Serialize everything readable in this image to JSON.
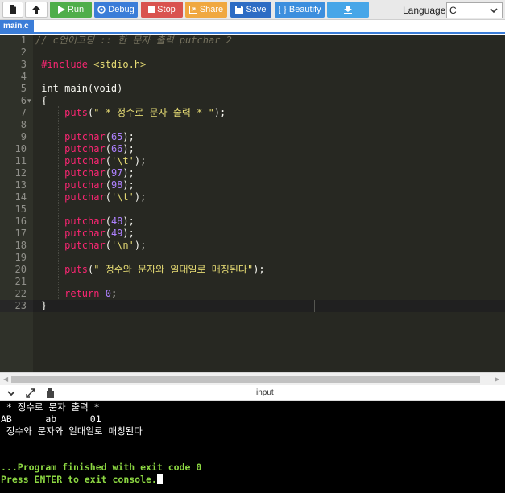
{
  "toolbar": {
    "run_label": "Run",
    "debug_label": "Debug",
    "stop_label": "Stop",
    "share_label": "Share",
    "save_label": "Save",
    "beautify_label": "{ } Beautify",
    "language_label": "Language",
    "language_value": "C"
  },
  "tab": {
    "name": "main.c"
  },
  "editor": {
    "line_numbers": [
      "1",
      "2",
      "3",
      "4",
      "5",
      "6",
      "7",
      "8",
      "9",
      "10",
      "11",
      "12",
      "13",
      "14",
      "15",
      "16",
      "17",
      "18",
      "19",
      "20",
      "21",
      "22",
      "23"
    ],
    "lines": [
      {
        "n": 1,
        "tokens": [
          [
            "c-comment",
            "// c언어코딩 :: 한 문자 출력 putchar 2"
          ]
        ]
      },
      {
        "n": 3,
        "tokens": [
          [
            "c-pre",
            " #include "
          ],
          [
            "c-hdr",
            "<stdio.h>"
          ]
        ]
      },
      {
        "n": 5,
        "tokens": [
          [
            "c-type",
            " int main(void)"
          ]
        ]
      },
      {
        "n": 6,
        "tokens": [
          [
            "c-plain",
            " {"
          ]
        ]
      },
      {
        "n": 7,
        "tokens": [
          [
            "c-fn",
            "     puts"
          ],
          [
            "c-plain",
            "("
          ],
          [
            "c-str",
            "\" * 정수로 문자 출력 * \""
          ],
          [
            "c-plain",
            ");"
          ]
        ]
      },
      {
        "n": 9,
        "tokens": [
          [
            "c-fn",
            "     putchar"
          ],
          [
            "c-plain",
            "("
          ],
          [
            "c-num",
            "65"
          ],
          [
            "c-plain",
            ");"
          ]
        ]
      },
      {
        "n": 10,
        "tokens": [
          [
            "c-fn",
            "     putchar"
          ],
          [
            "c-plain",
            "("
          ],
          [
            "c-num",
            "66"
          ],
          [
            "c-plain",
            ");"
          ]
        ]
      },
      {
        "n": 11,
        "tokens": [
          [
            "c-fn",
            "     putchar"
          ],
          [
            "c-plain",
            "("
          ],
          [
            "c-str",
            "'\\t'"
          ],
          [
            "c-plain",
            ");"
          ]
        ]
      },
      {
        "n": 12,
        "tokens": [
          [
            "c-fn",
            "     putchar"
          ],
          [
            "c-plain",
            "("
          ],
          [
            "c-num",
            "97"
          ],
          [
            "c-plain",
            ");"
          ]
        ]
      },
      {
        "n": 13,
        "tokens": [
          [
            "c-fn",
            "     putchar"
          ],
          [
            "c-plain",
            "("
          ],
          [
            "c-num",
            "98"
          ],
          [
            "c-plain",
            ");"
          ]
        ]
      },
      {
        "n": 14,
        "tokens": [
          [
            "c-fn",
            "     putchar"
          ],
          [
            "c-plain",
            "("
          ],
          [
            "c-str",
            "'\\t'"
          ],
          [
            "c-plain",
            ");"
          ]
        ]
      },
      {
        "n": 16,
        "tokens": [
          [
            "c-fn",
            "     putchar"
          ],
          [
            "c-plain",
            "("
          ],
          [
            "c-num",
            "48"
          ],
          [
            "c-plain",
            ");"
          ]
        ]
      },
      {
        "n": 17,
        "tokens": [
          [
            "c-fn",
            "     putchar"
          ],
          [
            "c-plain",
            "("
          ],
          [
            "c-num",
            "49"
          ],
          [
            "c-plain",
            ");"
          ]
        ]
      },
      {
        "n": 18,
        "tokens": [
          [
            "c-fn",
            "     putchar"
          ],
          [
            "c-plain",
            "("
          ],
          [
            "c-str",
            "'\\n'"
          ],
          [
            "c-plain",
            ");"
          ]
        ]
      },
      {
        "n": 20,
        "tokens": [
          [
            "c-fn",
            "     puts"
          ],
          [
            "c-plain",
            "("
          ],
          [
            "c-str",
            "\" 정수와 문자와 일대일로 매칭된다\""
          ],
          [
            "c-plain",
            ");"
          ]
        ]
      },
      {
        "n": 22,
        "tokens": [
          [
            "c-kw",
            "     return "
          ],
          [
            "c-num",
            "0"
          ],
          [
            "c-plain",
            ";"
          ]
        ]
      },
      {
        "n": 23,
        "tokens": [
          [
            "c-plain",
            " }"
          ]
        ]
      }
    ]
  },
  "console": {
    "title": "input",
    "output": [
      " * 정수로 문자 출력 *",
      "AB      ab      01",
      " 정수와 문자와 일대일로 매칭된다",
      "",
      "",
      "...Program finished with exit code 0",
      "Press ENTER to exit console."
    ]
  },
  "colors": {
    "editor_bg": "#272822",
    "run": "#4fae4a",
    "debug": "#3b7dd8",
    "stop": "#d9534f",
    "share": "#f0a840",
    "save": "#2d6cc4",
    "console_green": "#8cd742"
  }
}
